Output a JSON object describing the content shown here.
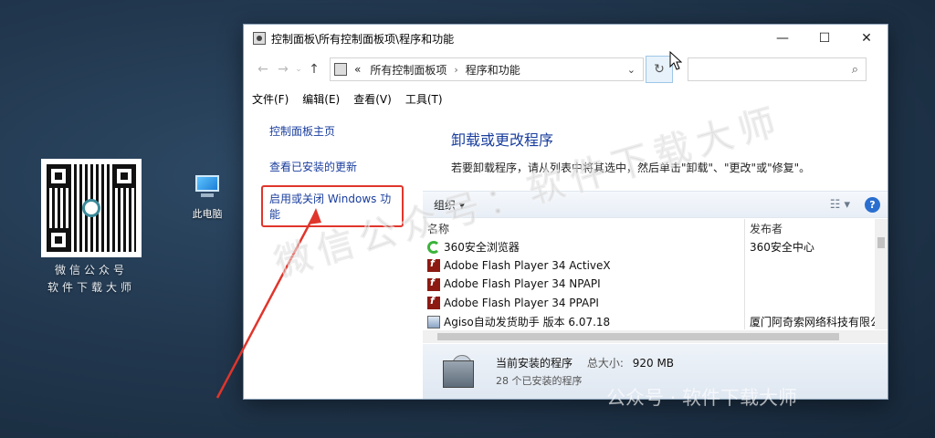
{
  "desktop": {
    "qr_caption_1": "微信公众号",
    "qr_caption_2": "软件下载大师",
    "pc_label": "此电脑"
  },
  "window": {
    "title": "控制面板\\所有控制面板项\\程序和功能",
    "controls": {
      "minimize": "—",
      "maximize": "☐",
      "close": "✕"
    },
    "address": {
      "prefix": "«",
      "crumbs": [
        "所有控制面板项",
        "程序和功能"
      ],
      "separator": "›",
      "dropdown": "⌄",
      "refresh": "↻"
    },
    "search": {
      "placeholder": "",
      "icon": "⌕"
    },
    "menu": [
      "文件(F)",
      "编辑(E)",
      "查看(V)",
      "工具(T)"
    ],
    "sidebar": {
      "items": [
        "控制面板主页",
        "查看已安装的更新",
        "启用或关闭 Windows 功能"
      ]
    },
    "main": {
      "title": "卸载或更改程序",
      "description": "若要卸载程序，请从列表中将其选中，然后单击\"卸载\"、\"更改\"或\"修复\"。"
    },
    "toolbar": {
      "organize": "组织 ▾",
      "views": "☷ ▾",
      "help": "?"
    },
    "list": {
      "columns": [
        "名称",
        "发布者"
      ],
      "rows": [
        {
          "name": "360安全浏览器",
          "publisher": "360安全中心",
          "icon": "360-browser-icon"
        },
        {
          "name": "Adobe Flash Player 34 ActiveX",
          "publisher": "",
          "icon": "flash-icon"
        },
        {
          "name": "Adobe Flash Player 34 NPAPI",
          "publisher": "",
          "icon": "flash-icon"
        },
        {
          "name": "Adobe Flash Player 34 PPAPI",
          "publisher": "",
          "icon": "flash-icon"
        },
        {
          "name": "Agiso自动发货助手 版本 6.07.18",
          "publisher": "厦门阿奇索网络科技有限公",
          "icon": "agiso-icon"
        }
      ]
    },
    "status": {
      "label": "当前安装的程序",
      "size_label": "总大小:",
      "size_value": "920 MB",
      "count": "28 个已安装的程序"
    }
  },
  "overlays": {
    "watermark": "微信公众号：软件下载大师",
    "bottom_watermark": "公众号 · 软件下载大师"
  },
  "colors": {
    "link": "#1a3e9e",
    "highlight_box": "#e0352b",
    "arrow": "#e0352b"
  }
}
